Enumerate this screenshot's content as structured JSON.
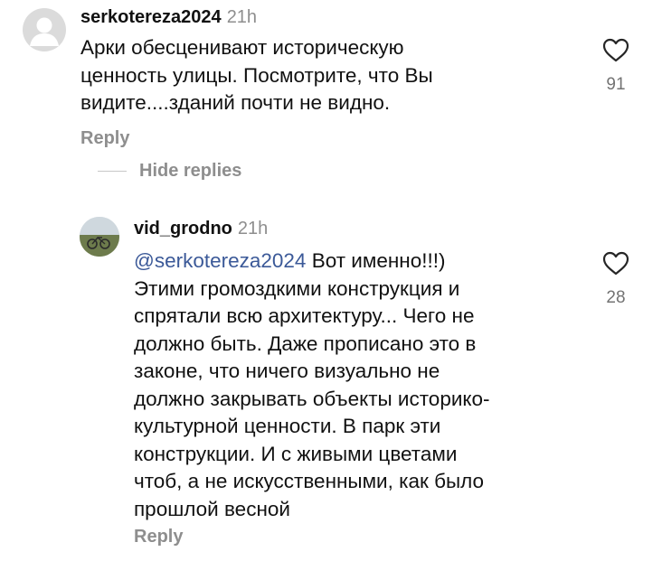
{
  "comments": [
    {
      "username": "serkotereza2024",
      "time": "21h",
      "text_lines": [
        "Арки обесценивают историческую",
        "ценность улицы. Посмотрите, что Вы",
        "видите....зданий почти не видно."
      ],
      "reply_label": "Reply",
      "likes": "91",
      "avatar_icon": "default-avatar-icon"
    },
    {
      "username": "vid_grodno",
      "time": "21h",
      "mention": "@serkotereza2024",
      "first_line_rest": " Вот именно!!!)",
      "text_lines": [
        "Этими громоздкими конструкция и",
        "спрятали всю архитектуру... Чего не",
        "должно быть. Даже прописано это в",
        "законе, что ничего визуально не",
        "должно закрывать объекты историко-",
        "культурной ценности. В парк эти",
        "конструкции. И с живыми цветами",
        "чтоб, а не искусственными, как было",
        "прошлой весной"
      ],
      "reply_label": "Reply",
      "likes": "28"
    }
  ],
  "hide_replies_label": "Hide replies",
  "colors": {
    "text": "#111111",
    "muted": "#8e8e8e",
    "mention": "#3b5998",
    "heart_stroke": "#262626"
  }
}
